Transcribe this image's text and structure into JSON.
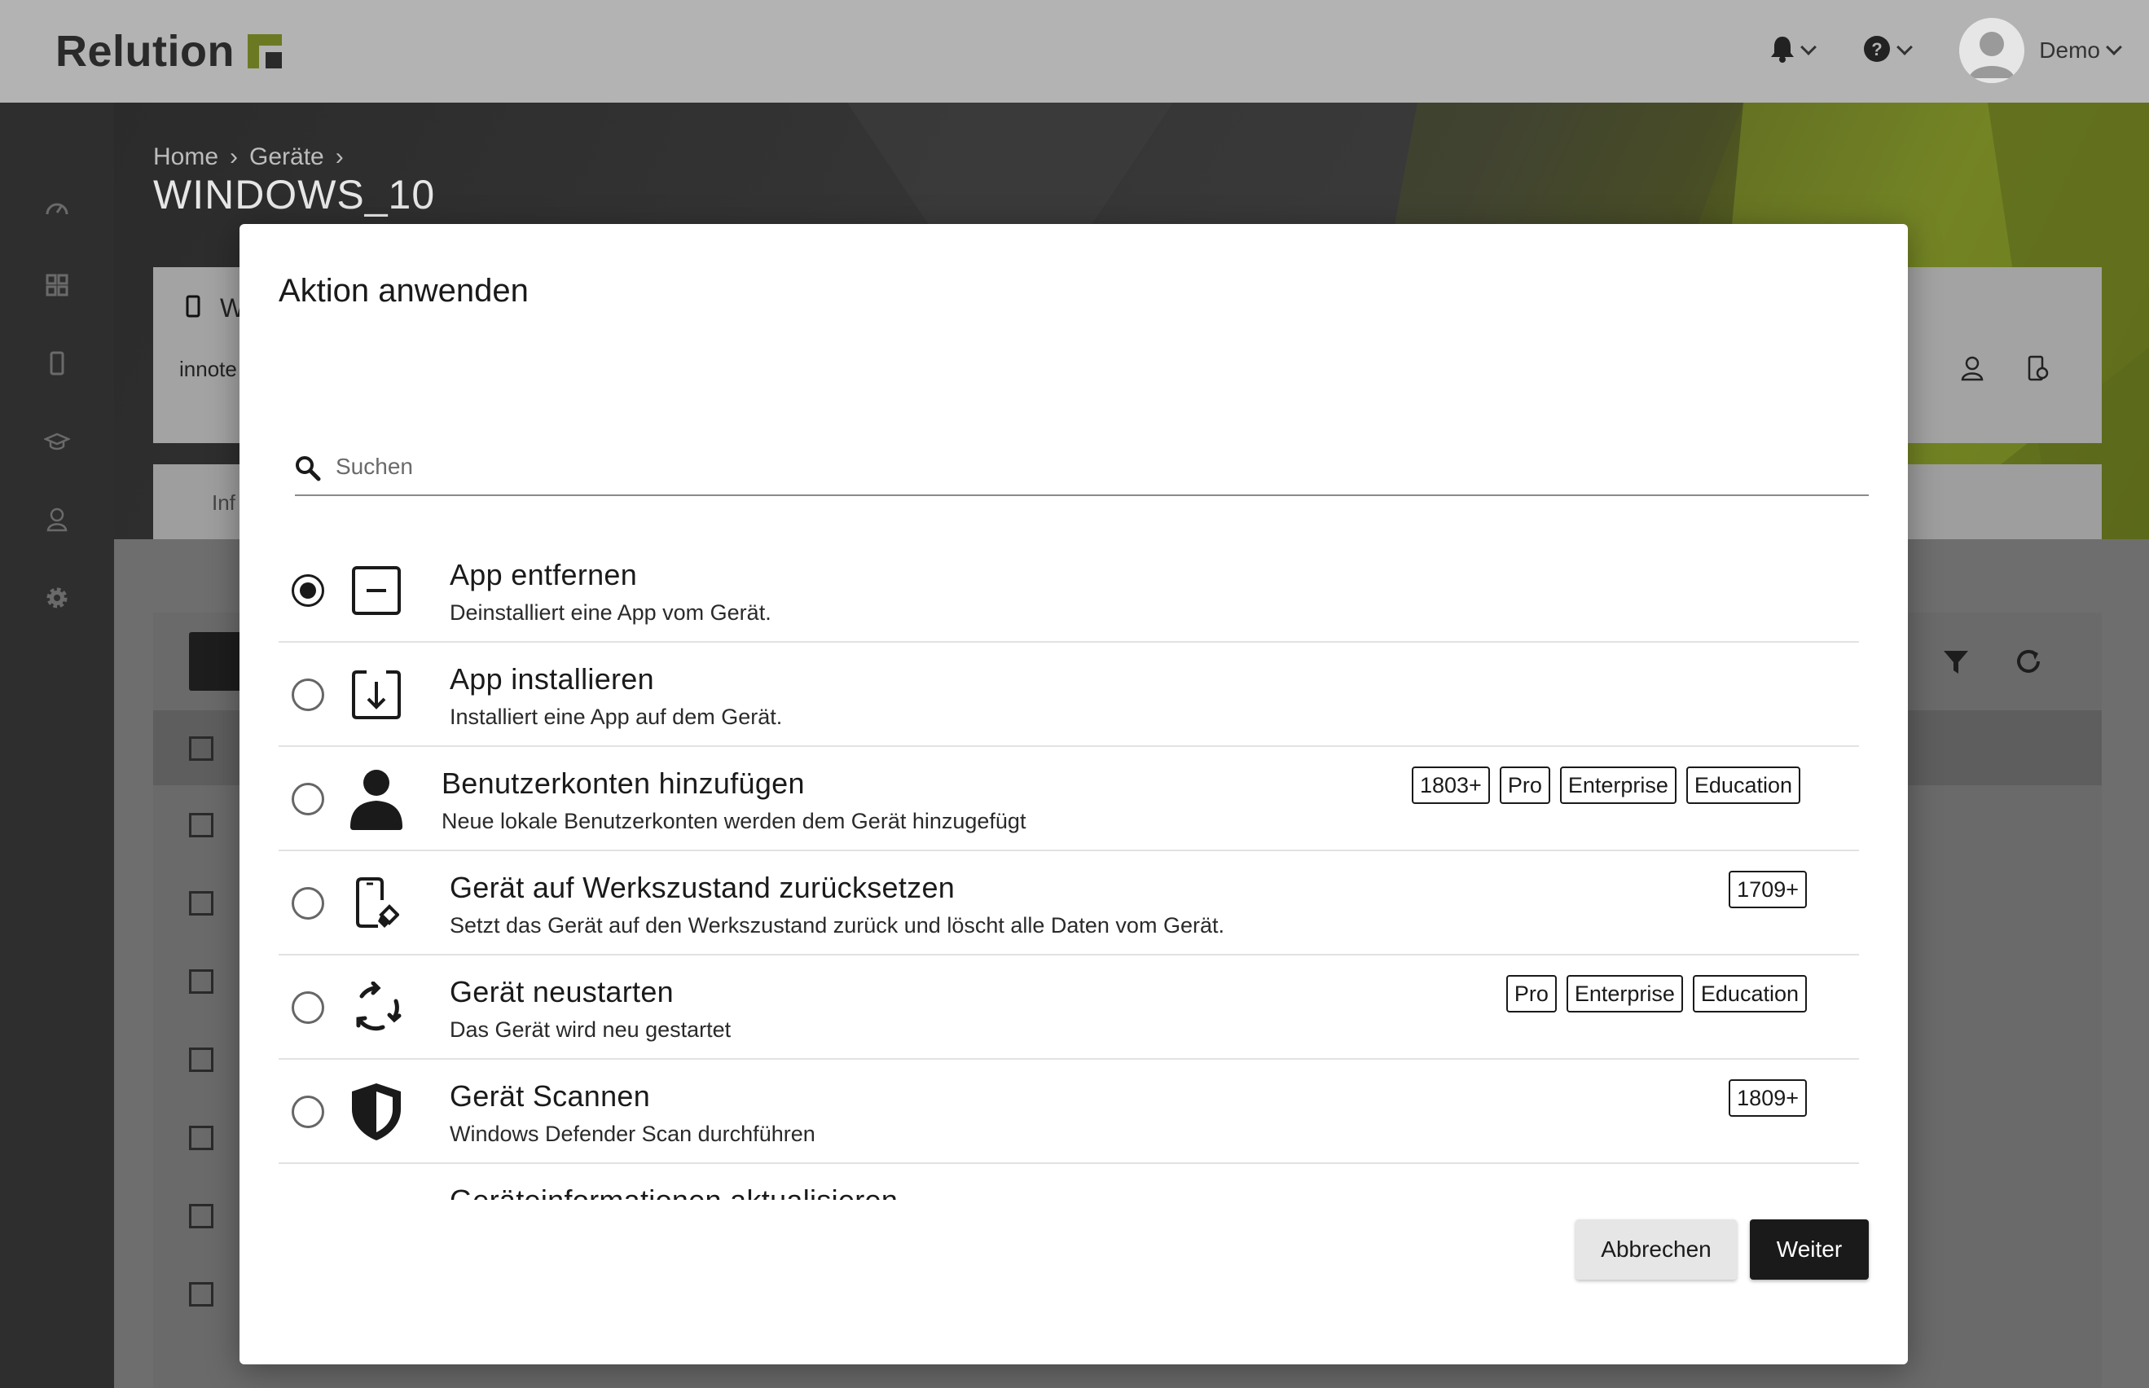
{
  "app": {
    "logo_text": "Relution",
    "user_name": "Demo"
  },
  "breadcrumb": [
    "Home",
    "Geräte"
  ],
  "page_title": "WINDOWS_10",
  "background": {
    "card_text_1": "W",
    "card_text_2": "innote",
    "tab_label": "Inf"
  },
  "modal": {
    "title": "Aktion anwenden",
    "search_placeholder": "Suchen",
    "actions": [
      {
        "title": "App entfernen",
        "description": "Deinstalliert eine App vom Gerät.",
        "icon": "app-remove-icon",
        "selected": true,
        "badges": []
      },
      {
        "title": "App installieren",
        "description": "Installiert eine App auf dem Gerät.",
        "icon": "app-install-icon",
        "selected": false,
        "badges": []
      },
      {
        "title": "Benutzerkonten hinzufügen",
        "description": "Neue lokale Benutzerkonten werden dem Gerät hinzugefügt",
        "icon": "user-icon",
        "selected": false,
        "badges": [
          "1803+",
          "Pro",
          "Enterprise",
          "Education"
        ]
      },
      {
        "title": "Gerät auf Werkszustand zurücksetzen",
        "description": "Setzt das Gerät auf den Werkszustand zurück und löscht alle Daten vom Gerät.",
        "icon": "device-wipe-icon",
        "selected": false,
        "badges": [
          "1709+"
        ]
      },
      {
        "title": "Gerät neustarten",
        "description": "Das Gerät wird neu gestartet",
        "icon": "restart-icon",
        "selected": false,
        "badges": [
          "Pro",
          "Enterprise",
          "Education"
        ]
      },
      {
        "title": "Gerät Scannen",
        "description": "Windows Defender Scan durchführen",
        "icon": "shield-icon",
        "selected": false,
        "badges": [
          "1809+"
        ]
      }
    ],
    "partial_next_title": "Geräteinformationen aktualisieren",
    "cancel_label": "Abbrechen",
    "next_label": "Weiter"
  },
  "colors": {
    "accent_dark": "#1a1a1a",
    "brand_green": "#6b7a22"
  }
}
